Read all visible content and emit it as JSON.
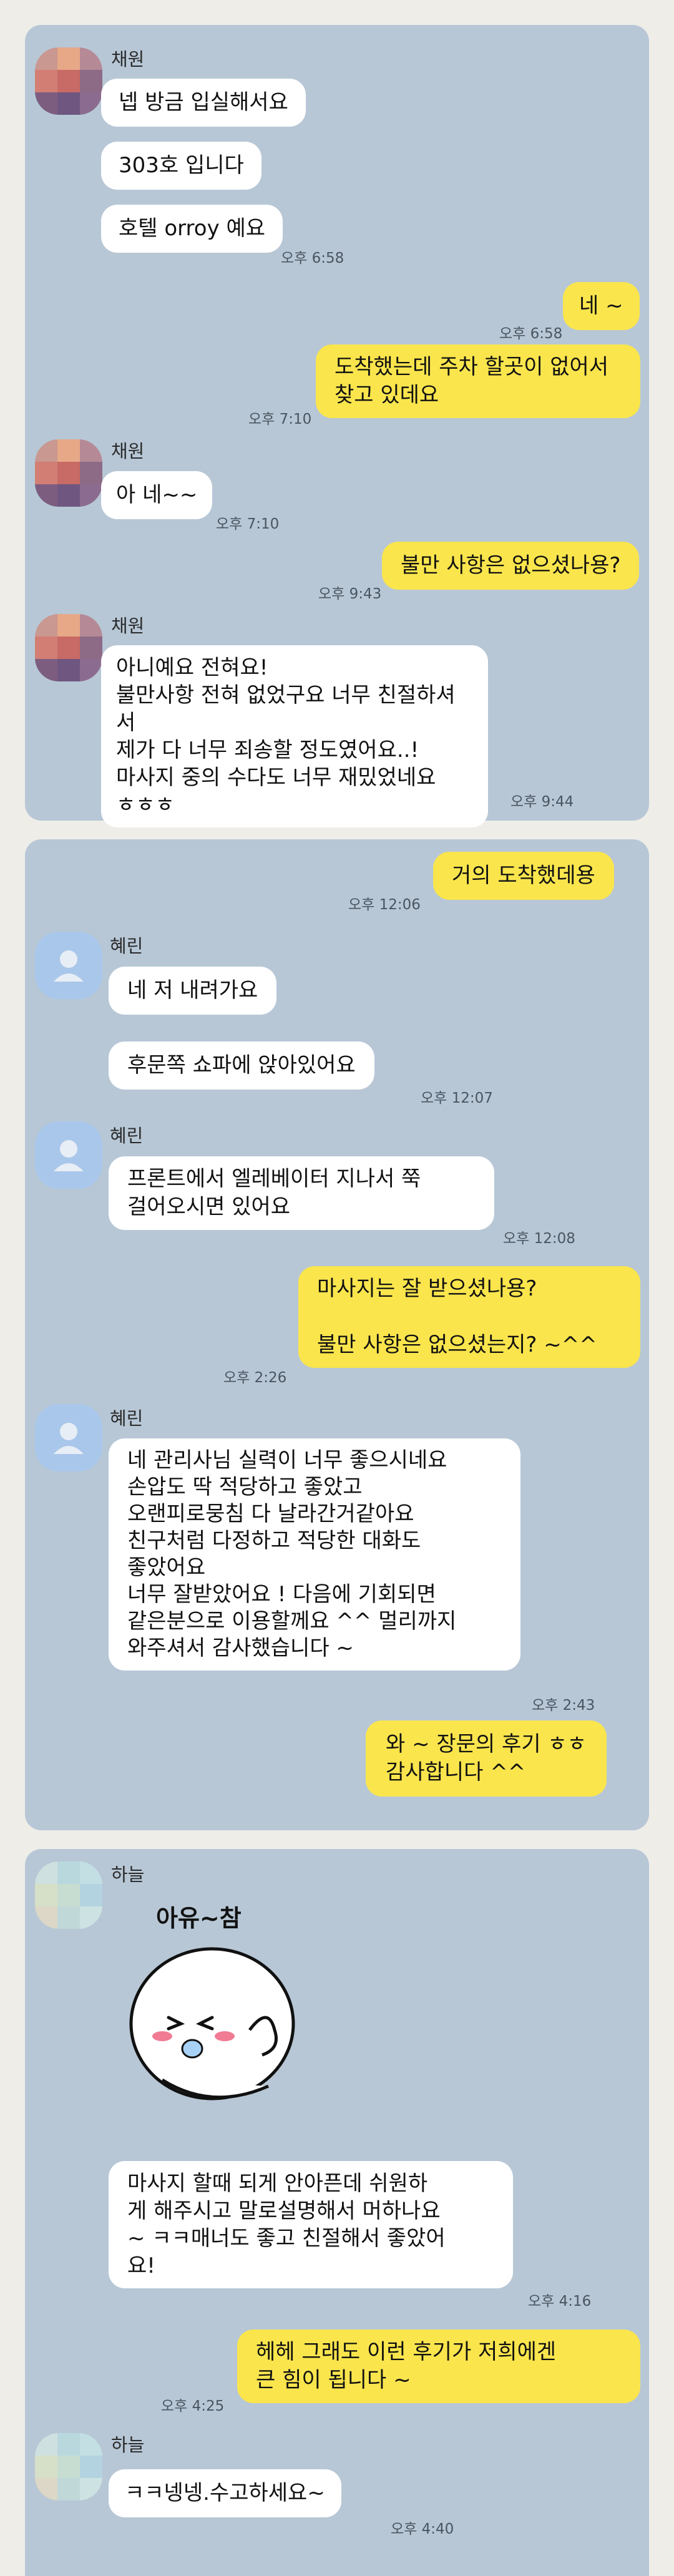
{
  "conv1": {
    "sender": "채원",
    "msgs": [
      {
        "text": "넵 방금 입실해서요"
      },
      {
        "text": "303호 입니다"
      },
      {
        "text": "호텔 orroy 예요",
        "time": "오후 6:58"
      }
    ],
    "out1": {
      "text": "네 ~",
      "time": "오후 6:58"
    },
    "out2": {
      "text": "도착했는데  주차 할곳이 없어서\n찾고 있데요",
      "time": "오후 7:10"
    },
    "in2": {
      "sender": "채원",
      "text": "아 네~~",
      "time": "오후 7:10"
    },
    "out3": {
      "text": "불만 사항은 없으셨나용?",
      "time": "오후 9:43"
    },
    "in3": {
      "sender": "채원",
      "text": "아니예요 전혀요!\n불만사항 전혀 없었구요 너무 친절하셔서\n제가 다 너무 죄송할 정도였어요..!\n마사지 중의 수다도 너무 재밌었네요\nㅎㅎㅎ",
      "time": "오후 9:44"
    }
  },
  "conv2": {
    "out1": {
      "text": "거의 도착했데용",
      "time": "오후 12:06"
    },
    "in1": {
      "sender": "혜린",
      "msg1": "네 저 내려가요",
      "msg2": "후문쪽 쇼파에 앉아있어요",
      "time": "오후 12:07"
    },
    "in2": {
      "sender": "혜린",
      "text": "프론트에서 엘레베이터 지나서 쭉\n걸어오시면 있어요",
      "time": "오후 12:08"
    },
    "out2": {
      "text": "마사지는 잘 받으셨나용?\n\n불만 사항은 없으셨는지? ~^^",
      "time": "오후 2:26"
    },
    "in3": {
      "sender": "혜린",
      "text": "네 관리사님 실력이 너무 좋으시네요\n손압도 딱 적당하고 좋았고\n오랜피로뭉침 다 날라간거같아요\n친구처럼 다정하고 적당한 대화도\n좋았어요\n너무 잘받았어요 ! 다음에 기회되면\n같은분으로 이용할께요 ^^ 멀리까지\n와주셔서 감사했습니다 ~",
      "time": "오후 2:43"
    },
    "out3": {
      "text": "와 ~ 장문의 후기 ㅎㅎ\n감사합니다 ^^",
      "time": ""
    }
  },
  "conv3": {
    "sender": "하늘",
    "sticker_caption": "아유~참",
    "in1": {
      "text": "마사지 할때 되게 안아픈데 쉬원하\n게 해주시고 말로설명해서 머하나요\n~ ㅋㅋ매너도 좋고 친절해서 좋았어\n요!",
      "time": "오후 4:16"
    },
    "out1": {
      "text": "헤헤 그래도 이런 후기가 저희에겐\n큰 힘이 됩니다 ~",
      "time": "오후 4:25"
    },
    "in2": {
      "sender": "하늘",
      "text": "ㅋㅋ넹넹.수고하세요~",
      "time": "오후 4:40"
    }
  },
  "colors": {
    "incoming": "#ffffff",
    "outgoing": "#fae54d",
    "chat_bg": "#b7c7d6",
    "page_bg": "#eeede8"
  },
  "icons": [
    "pixelated-avatar",
    "person-avatar",
    "seal-sticker"
  ]
}
